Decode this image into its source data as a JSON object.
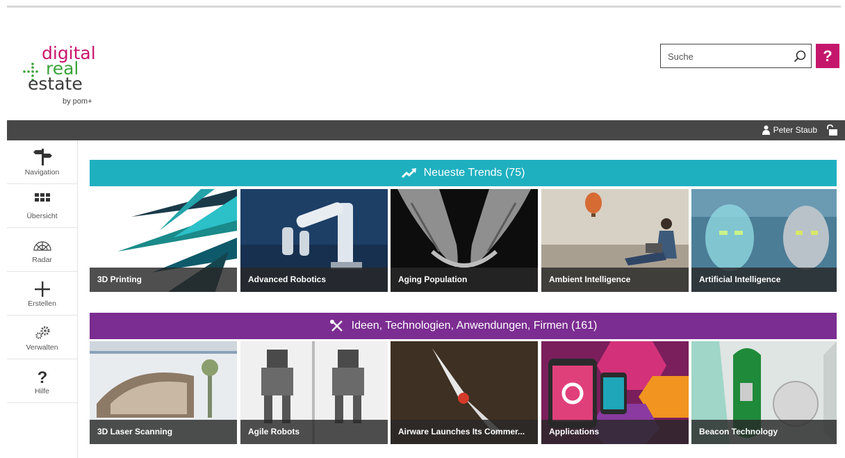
{
  "brand": {
    "line1": "digital",
    "line2": "real",
    "line3": "estate",
    "byline": "by pom+",
    "colors": {
      "magenta": "#c9156c",
      "green": "#3aa33a",
      "dark": "#3b3b3b"
    }
  },
  "search": {
    "placeholder": "Suche",
    "help_label": "?"
  },
  "topbar": {
    "user_name": "Peter Staub"
  },
  "sidebar": {
    "items": [
      {
        "label": "Navigation",
        "icon": "signpost-icon"
      },
      {
        "label": "Übersicht",
        "icon": "grid-icon"
      },
      {
        "label": "Radar",
        "icon": "radar-icon"
      },
      {
        "label": "Erstellen",
        "icon": "plus-icon"
      },
      {
        "label": "Verwalten",
        "icon": "gears-icon"
      },
      {
        "label": "Hilfe",
        "icon": "question-icon"
      }
    ]
  },
  "sections": [
    {
      "title": "Neueste Trends (75)",
      "icon": "trend-up-icon",
      "color": "#1fb0c0",
      "tiles": [
        "3D Printing",
        "Advanced Robotics",
        "Aging Population",
        "Ambient Intelligence",
        "Artificial Intelligence"
      ]
    },
    {
      "title": "Ideen, Technologien, Anwendungen, Firmen (161)",
      "icon": "tools-icon",
      "color": "#7b2d91",
      "tiles": [
        "3D Laser Scanning",
        "Agile Robots",
        "Airware Launches Its Commer...",
        "Applications",
        "Beacon Technology"
      ]
    }
  ],
  "tile_images": {
    "0": [
      "#ffffff",
      "#1c2a4a",
      "#0d0d0d",
      "#c9c1b4",
      "#3f6e8a"
    ],
    "1": [
      "#e9ecef",
      "#f0f0f0",
      "#4a3b2a",
      "#7a1f5c",
      "#dfe5e3"
    ]
  }
}
